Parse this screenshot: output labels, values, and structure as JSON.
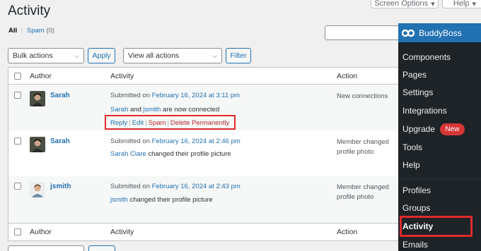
{
  "top_tabs": {
    "screen_options": "Screen Options",
    "help": "Help"
  },
  "page": {
    "title": "Activity"
  },
  "filters": {
    "all": "All",
    "separator": "|",
    "spam": "Spam",
    "spam_count": "(0)"
  },
  "bulk": {
    "select_label": "Bulk actions",
    "apply": "Apply",
    "view_select": "View all actions",
    "filter": "Filter"
  },
  "table": {
    "columns": {
      "author": "Author",
      "activity": "Activity",
      "action": "Action"
    },
    "rows": [
      {
        "author": "Sarah",
        "submitted_prefix": "Submitted on",
        "date": "February 16, 2024 at 3:11 pm",
        "content": {
          "user1": "Sarah",
          "and": "and",
          "user2": "jsmith",
          "rest": "are now connected"
        },
        "row_actions": {
          "reply": "Reply",
          "edit": "Edit",
          "spam": "Spam",
          "delete": "Delete Permanently"
        },
        "action": "New connections"
      },
      {
        "author": "Sarah",
        "submitted_prefix": "Submitted on",
        "date": "February 16, 2024 at 2:46 pm",
        "content": {
          "user": "Sarah Clare",
          "rest": "changed their profile picture"
        },
        "action": "Member changed profile photo"
      },
      {
        "author": "jsmith",
        "submitted_prefix": "Submitted on",
        "date": "February 16, 2024 at 2:43 pm",
        "content": {
          "user": "jsmith",
          "rest": "changed their profile picture"
        },
        "action": "Member changed profile photo"
      }
    ]
  },
  "admin_menu": {
    "brand": "BuddyBoss",
    "items": [
      "Components",
      "Pages",
      "Settings",
      "Integrations",
      "Upgrade",
      "Tools",
      "Help",
      "Profiles",
      "Groups",
      "Activity",
      "Emails"
    ],
    "upgrade_badge": "New"
  },
  "colors": {
    "accent": "#2271b1",
    "highlight": "#e02b2b",
    "menu_bg": "#1d2327",
    "badge": "#d63638"
  }
}
